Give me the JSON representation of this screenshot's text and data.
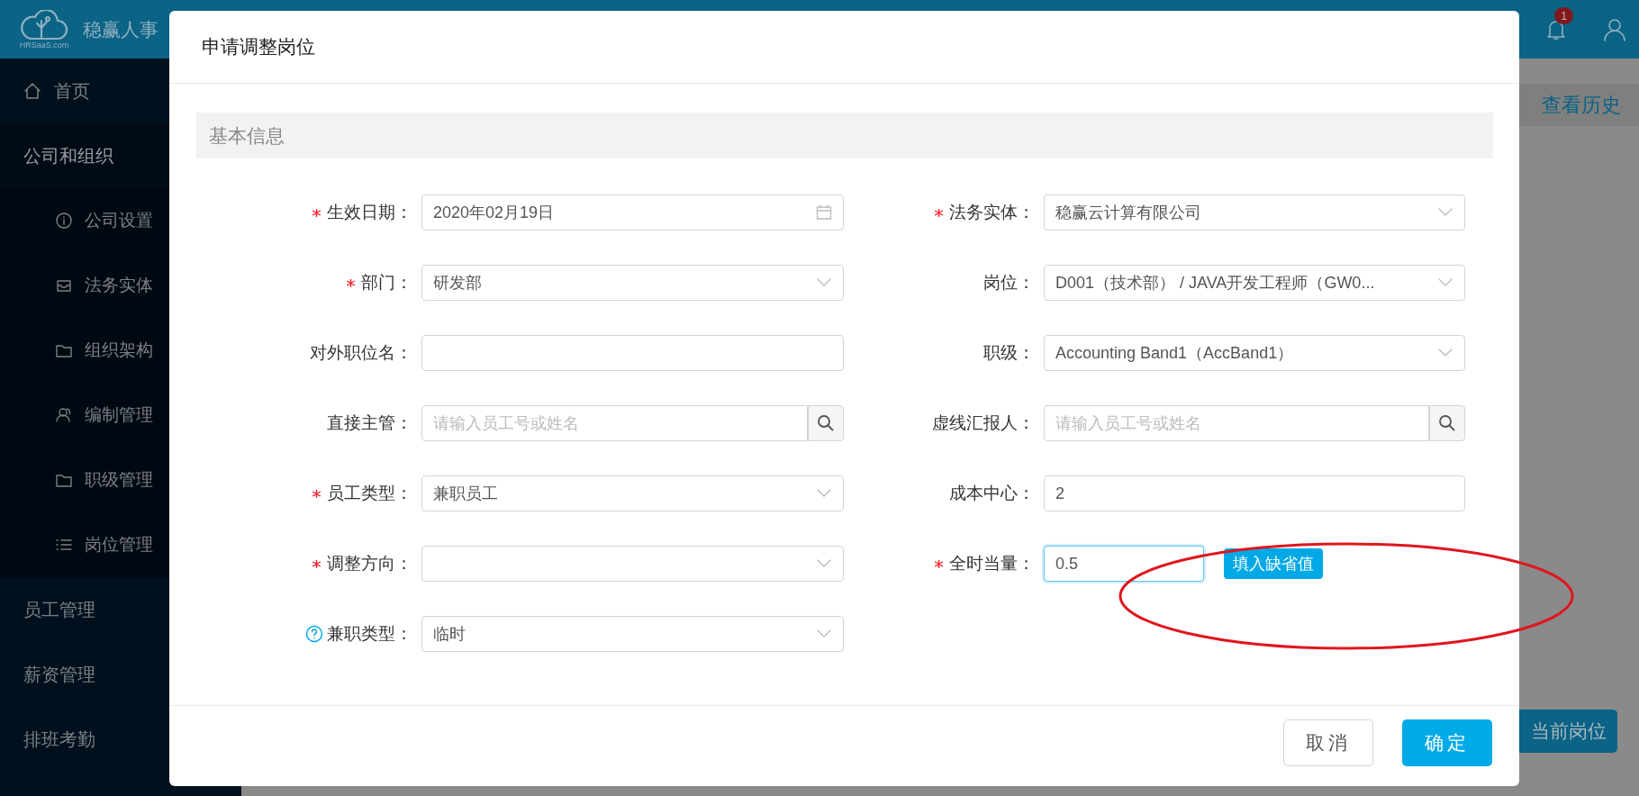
{
  "topbar": {
    "logo_text": "稳赢人事",
    "logo_caption": "HRSaaS.com",
    "notification_count": "1"
  },
  "sidebar": {
    "items": [
      {
        "label": "首页"
      },
      {
        "label": "公司和组织",
        "expanded": true,
        "children": [
          {
            "label": "公司设置"
          },
          {
            "label": "法务实体"
          },
          {
            "label": "组织架构"
          },
          {
            "label": "编制管理"
          },
          {
            "label": "职级管理"
          },
          {
            "label": "岗位管理"
          }
        ]
      },
      {
        "label": "员工管理"
      },
      {
        "label": "薪资管理"
      },
      {
        "label": "排班考勤"
      }
    ]
  },
  "main": {
    "history_link": "查看历史",
    "current_position_button": "当前岗位"
  },
  "dialog": {
    "title": "申请调整岗位",
    "section_title": "基本信息",
    "left_fields": [
      {
        "label": "生效日期：",
        "required": true,
        "help": false,
        "kind": "date",
        "value": "2020年02月19日",
        "focused": false
      },
      {
        "label": "部门：",
        "required": true,
        "help": false,
        "kind": "select",
        "value": "研发部",
        "focused": false
      },
      {
        "label": "对外职位名：",
        "required": false,
        "help": false,
        "kind": "text",
        "focused": false
      },
      {
        "label": "直接主管：",
        "required": false,
        "help": false,
        "kind": "search",
        "placeholder": "请输入员工号或姓名",
        "focused": false
      },
      {
        "label": "员工类型：",
        "required": true,
        "help": false,
        "kind": "select",
        "value": "兼职员工",
        "focused": false
      },
      {
        "label": "调整方向：",
        "required": true,
        "help": false,
        "kind": "select",
        "focused": false
      },
      {
        "label": "兼职类型：",
        "required": false,
        "help": true,
        "kind": "select",
        "value": "临时",
        "focused": false
      }
    ],
    "right_fields": [
      {
        "label": "法务实体：",
        "required": true,
        "help": false,
        "kind": "select",
        "value": "稳赢云计算有限公司",
        "focused": false
      },
      {
        "label": "岗位：",
        "required": false,
        "help": false,
        "kind": "select",
        "value": "D001（技术部） / JAVA开发工程师（GW0...",
        "focused": false
      },
      {
        "label": "职级：",
        "required": false,
        "help": false,
        "kind": "select",
        "value": "Accounting Band1（AccBand1）",
        "focused": false
      },
      {
        "label": "虚线汇报人：",
        "required": false,
        "help": false,
        "kind": "search",
        "placeholder": "请输入员工号或姓名",
        "focused": false
      },
      {
        "label": "成本中心：",
        "required": false,
        "help": false,
        "kind": "text",
        "value": "2",
        "focused": false
      },
      {
        "label": "全时当量：",
        "required": true,
        "help": false,
        "kind": "number",
        "value": "0.5",
        "focused": true,
        "action": "填入缺省值"
      }
    ],
    "buttons": [
      {
        "label": "取消",
        "kind": "default"
      },
      {
        "label": "确定",
        "kind": "primary"
      }
    ]
  }
}
